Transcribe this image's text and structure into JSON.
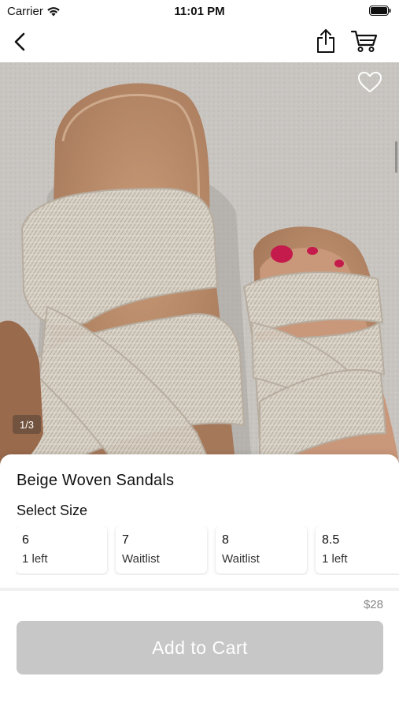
{
  "status_bar": {
    "carrier": "Carrier",
    "time": "11:01 PM"
  },
  "nav": {
    "back_icon": "chevron-left-icon",
    "share_icon": "share-icon",
    "cart_icon": "cart-icon"
  },
  "gallery": {
    "counter": "1/3",
    "favorite_icon": "heart-outline-icon"
  },
  "product": {
    "title": "Beige Woven Sandals",
    "select_size_label": "Select Size",
    "sizes": [
      {
        "size": "6",
        "stock": "1 left"
      },
      {
        "size": "7",
        "stock": "Waitlist"
      },
      {
        "size": "8",
        "stock": "Waitlist"
      },
      {
        "size": "8.5",
        "stock": "1 left"
      }
    ],
    "price": "$28",
    "add_to_cart_label": "Add to Cart"
  },
  "colors": {
    "button_disabled": "#c7c7c7",
    "price_text": "#888888"
  }
}
